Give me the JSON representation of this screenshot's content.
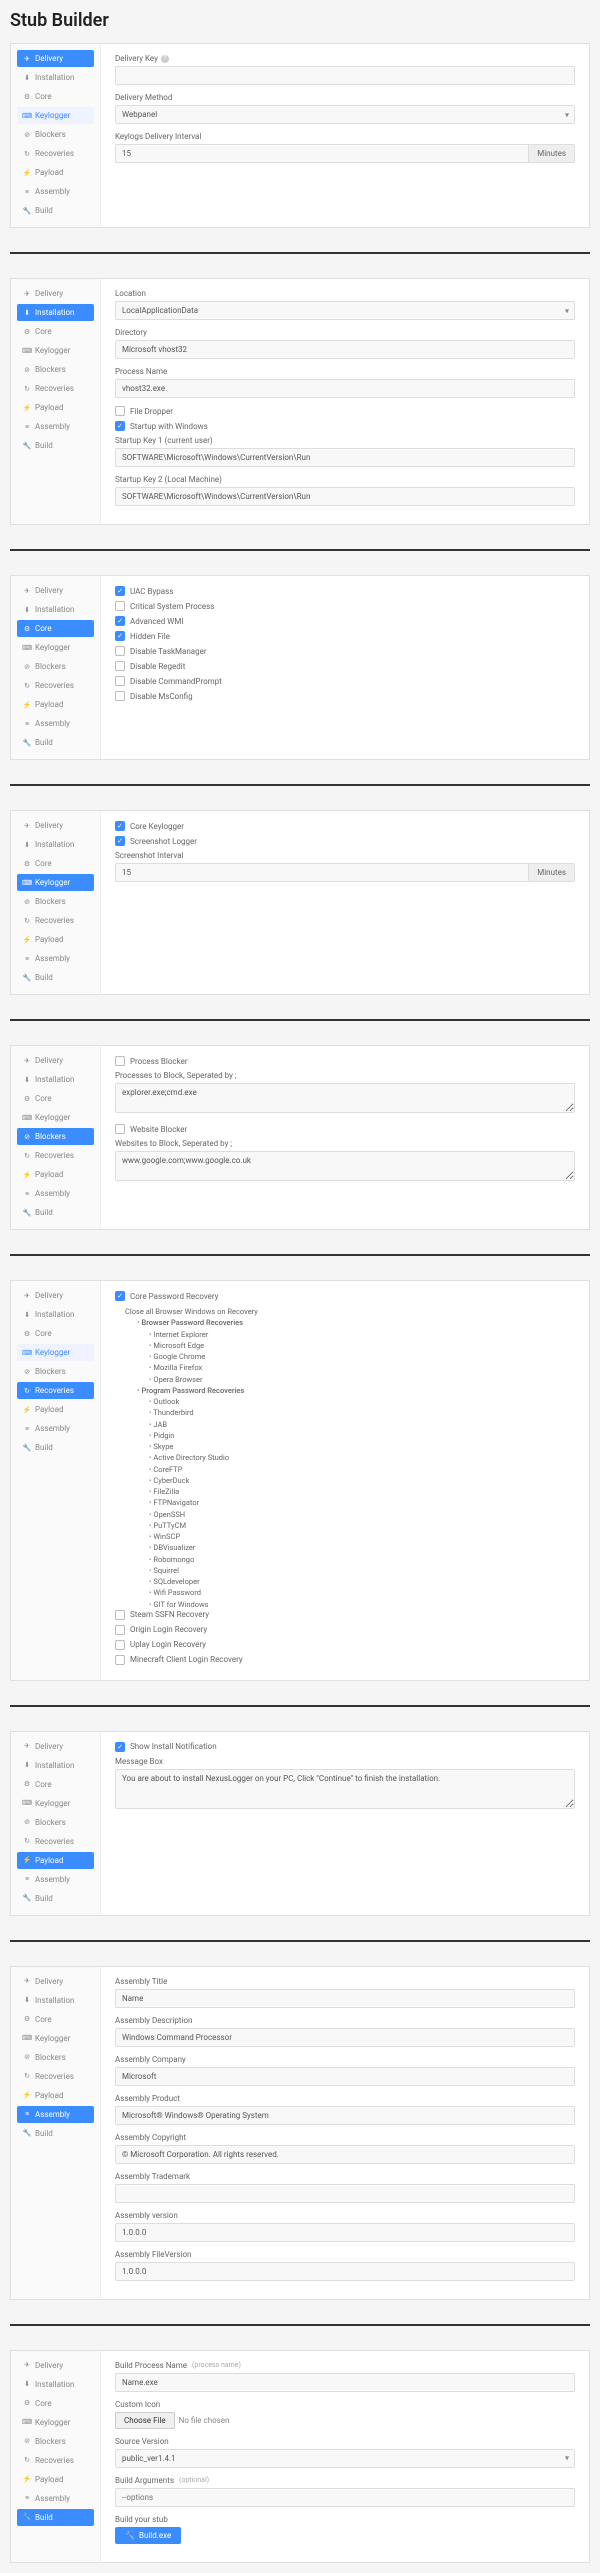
{
  "page_title": "Stub Builder",
  "nav": {
    "delivery": "Delivery",
    "installation": "Installation",
    "core": "Core",
    "keylogger": "Keylogger",
    "blockers": "Blockers",
    "recoveries": "Recoveries",
    "payload": "Payload",
    "assembly": "Assembly",
    "build": "Build"
  },
  "delivery": {
    "key_label": "Delivery Key",
    "method_label": "Delivery Method",
    "method_value": "Webpanel",
    "interval_label": "Keylogs Delivery Interval",
    "interval_value": "15",
    "interval_unit": "Minutes"
  },
  "installation": {
    "location_label": "Location",
    "location_value": "LocalApplicationData",
    "directory_label": "Directory",
    "directory_value": "Microsoft vhost32",
    "process_label": "Process Name",
    "process_value": "vhost32.exe",
    "file_dropper": "File Dropper",
    "startup": "Startup with Windows",
    "startup_key1_label": "Startup Key 1 (current user)",
    "startup_key1_value": "SOFTWARE\\Microsoft\\Windows\\CurrentVersion\\Run",
    "startup_key2_label": "Startup Key 2 (Local Machine)",
    "startup_key2_value": "SOFTWARE\\Microsoft\\Windows\\CurrentVersion\\Run"
  },
  "core": {
    "uac": "UAC Bypass",
    "critical": "Critical System Process",
    "wmi": "Advanced WMI",
    "hidden": "Hidden File",
    "taskmgr": "Disable TaskManager",
    "regedit": "Disable Regedit",
    "cmd": "Disable CommandPrompt",
    "msconfig": "Disable MsConfig"
  },
  "keylogger": {
    "core": "Core Keylogger",
    "screenshot": "Screenshot Logger",
    "interval_label": "Screenshot Interval",
    "interval_value": "15",
    "interval_unit": "Minutes"
  },
  "blockers": {
    "process_blocker": "Process Blocker",
    "processes_label": "Processes to Block, Seperated by ;",
    "processes_value": "explorer.exe;cmd.exe",
    "website_blocker": "Website Blocker",
    "websites_label": "Websites to Block, Seperated by ;",
    "websites_value": "www.google.com;www.google.co.uk"
  },
  "recoveries": {
    "core": "Core Password Recovery",
    "close_browser": "Close all Browser Windows on Recovery",
    "browser_section": "Browser Password Recoveries",
    "browsers": [
      "Internet Explorer",
      "Microsoft Edge",
      "Google Chrome",
      "Mozilla Firefox",
      "Opera Browser"
    ],
    "program_section": "Program Password Recoveries",
    "programs": [
      "Outlook",
      "Thunderbird",
      "JAB",
      "Pidgin",
      "Skype",
      "Active Directory Studio",
      "CoreFTP",
      "CyberDuck",
      "FileZilla",
      "FTPNavigator",
      "OpenSSH",
      "PuTTyCM",
      "WinSCP",
      "DBVisualizer",
      "Robomongo",
      "Squirrel",
      "SQLdeveloper",
      "Wifi Password",
      "GIT for Windows"
    ],
    "steam": "Steam SSFN Recovery",
    "origin": "Origin Login Recovery",
    "uplay": "Uplay Login Recovery",
    "minecraft": "Minecraft Client Login Recovery"
  },
  "payload": {
    "show_notif": "Show Install Notification",
    "msgbox_label": "Message Box",
    "msgbox_value": "You are about to install NexusLogger on your PC, Click \"Continue\" to finish the installation."
  },
  "assembly": {
    "title_label": "Assembly Title",
    "title_value": "Name",
    "desc_label": "Assembly Description",
    "desc_value": "Windows Command Processor",
    "company_label": "Assembly Company",
    "company_value": "Microsoft",
    "product_label": "Assembly Product",
    "product_value": "Microsoft® Windows® Operating System",
    "copyright_label": "Assembly Copyright",
    "copyright_value": "© Microsoft Corporation. All rights reserved.",
    "trademark_label": "Assembly Trademark",
    "version_label": "Assembly version",
    "version_value": "1.0.0.0",
    "fileversion_label": "Assembly FileVersion",
    "fileversion_value": "1.0.0.0"
  },
  "build": {
    "process_label": "Build Process Name",
    "process_note": "(process name)",
    "process_value": "Name.exe",
    "icon_label": "Custom Icon",
    "choose_file": "Choose File",
    "no_file": "No file chosen",
    "source_label": "Source Version",
    "source_value": "public_ver1.4.1",
    "args_label": "Build Arguments",
    "args_note": "(optional)",
    "args_placeholder": "--options",
    "build_label": "Build your stub",
    "build_btn": "Build.exe"
  }
}
